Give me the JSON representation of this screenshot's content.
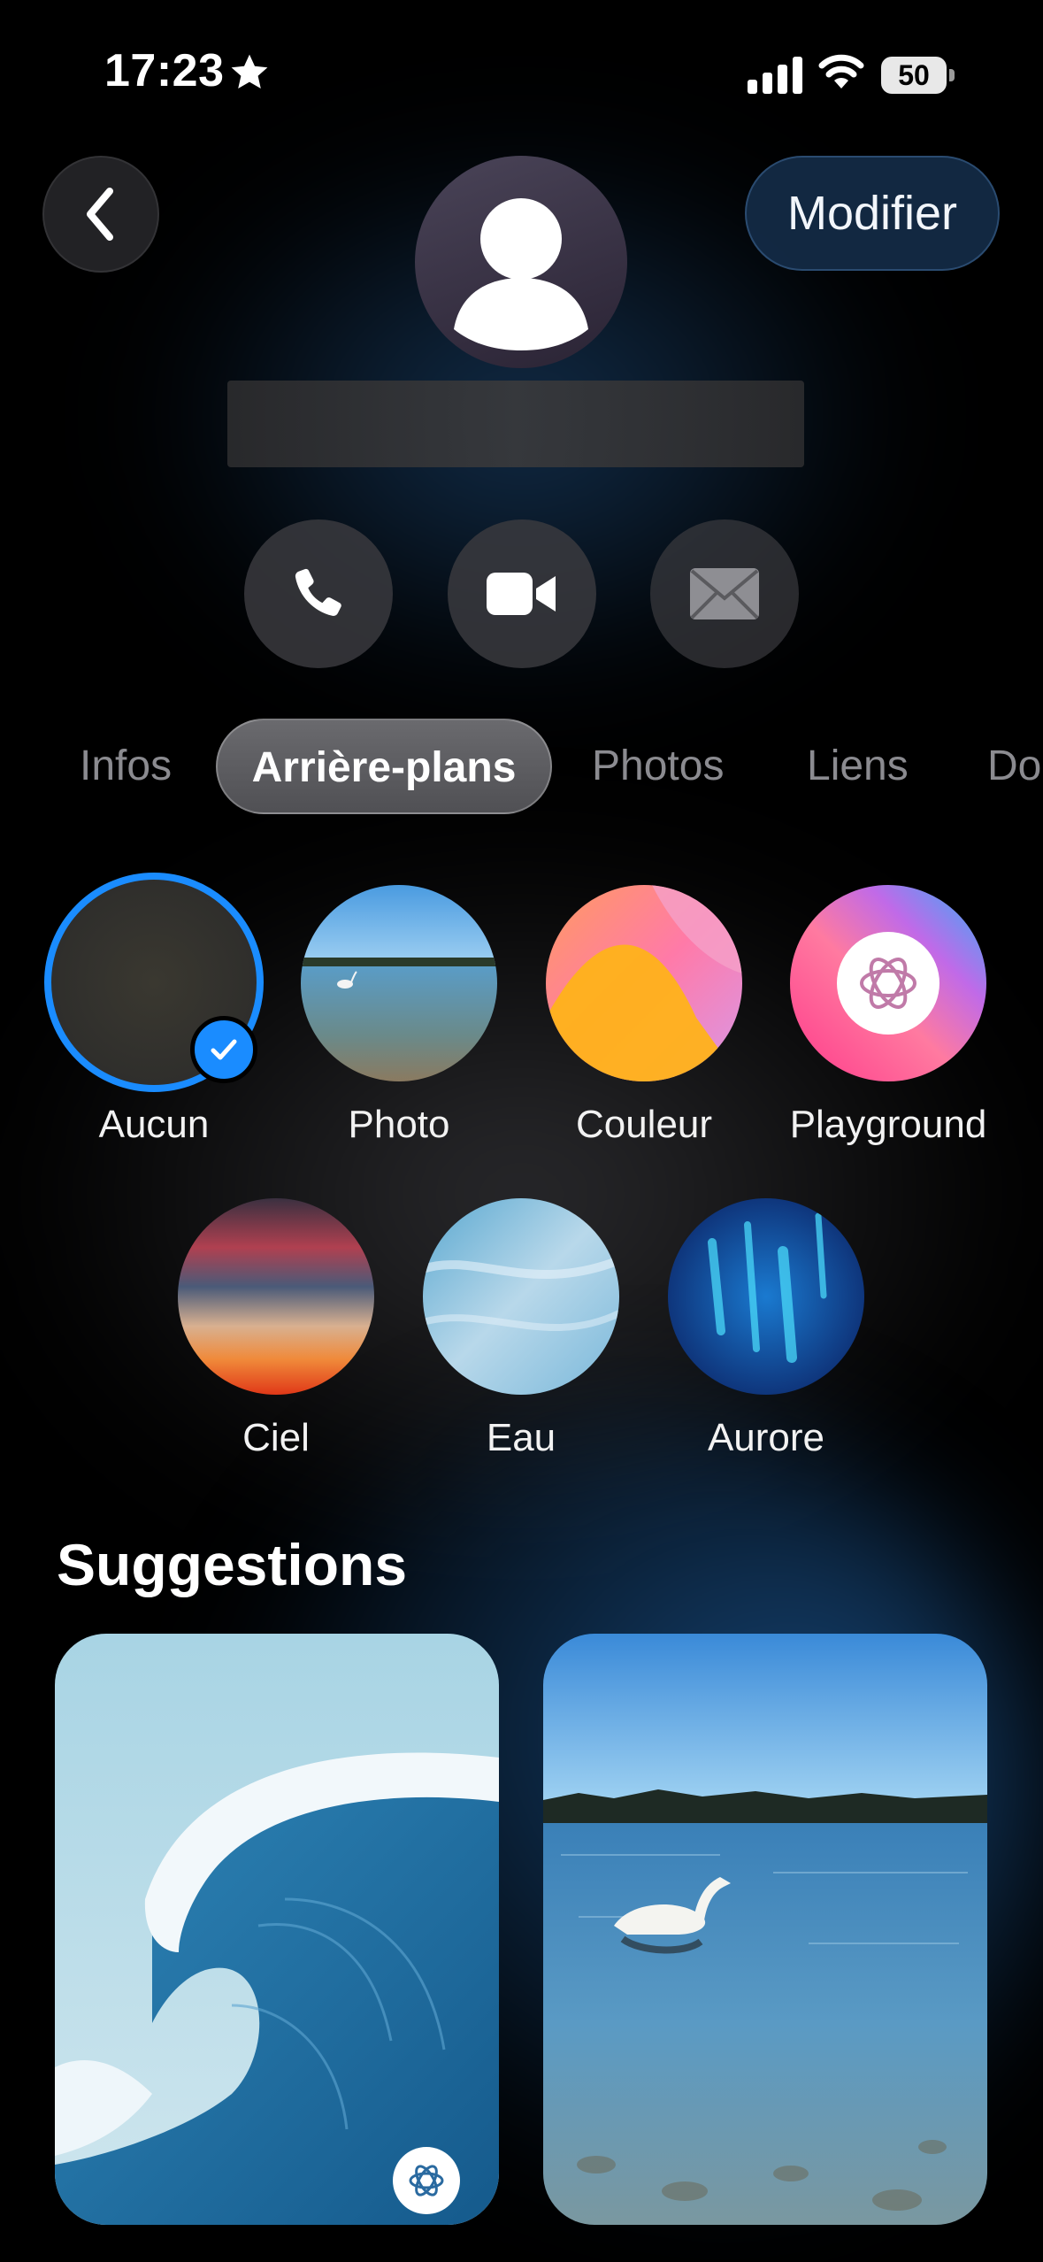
{
  "status_bar": {
    "time": "17:23",
    "battery_percent": "50",
    "icons": [
      "star-icon",
      "cellular-signal-icon",
      "wifi-icon",
      "battery-icon"
    ]
  },
  "header": {
    "back_icon": "chevron-left-icon",
    "edit_label": "Modifier",
    "avatar_icon": "person-icon"
  },
  "actions": [
    {
      "icon": "phone-icon"
    },
    {
      "icon": "video-camera-icon"
    },
    {
      "icon": "mail-icon"
    }
  ],
  "tabs": {
    "items": [
      "Infos",
      "Arrière-plans",
      "Photos",
      "Liens",
      "Do"
    ],
    "selected": "Arrière-plans"
  },
  "backgrounds": {
    "items": [
      "Aucun",
      "Photo",
      "Couleur",
      "Playground",
      "Ciel",
      "Eau",
      "Aurore"
    ],
    "selected": "Aucun"
  },
  "suggestions": {
    "title": "Suggestions"
  },
  "colors": {
    "accent": "#1a8cff",
    "background": "#000000"
  }
}
